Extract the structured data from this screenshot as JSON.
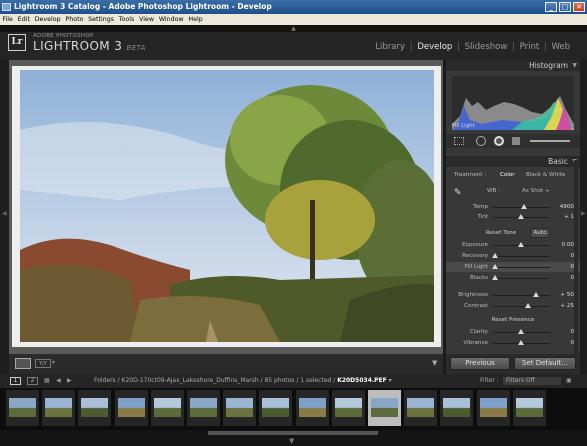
{
  "window": {
    "title": "Lightroom 3 Catalog - Adobe Photoshop Lightroom - Develop",
    "min": "_",
    "max": "□",
    "close": "✕"
  },
  "menu": [
    "File",
    "Edit",
    "Develop",
    "Photo",
    "Settings",
    "Tools",
    "View",
    "Window",
    "Help"
  ],
  "identity": {
    "adobe": "ADOBE PHOTOSHOP",
    "name": "LIGHTROOM 3",
    "beta": "BETA",
    "logo": "Lr"
  },
  "modules": [
    "Library",
    "Develop",
    "Slideshow",
    "Print",
    "Web"
  ],
  "panels": {
    "histogram": {
      "title": "Histogram",
      "label": "Fill Light"
    },
    "basic": {
      "title": "Basic",
      "treatment_label": "Treatment :",
      "color": "Color",
      "bw": "Black & White",
      "wb_label": "WB :",
      "wb_value": "As Shot ÷",
      "temp": {
        "label": "Temp",
        "value": "4900",
        "pos": 0.55
      },
      "tint": {
        "label": "Tint",
        "value": "+ 1",
        "pos": 0.5
      },
      "tone_label": "Reset Tone",
      "auto": "Auto",
      "exposure": {
        "label": "Exposure",
        "value": "0.00",
        "pos": 0.5
      },
      "recovery": {
        "label": "Recovery",
        "value": "0",
        "pos": 0.05
      },
      "filllight": {
        "label": "Fill Light",
        "value": "0",
        "pos": 0.05
      },
      "blacks": {
        "label": "Blacks",
        "value": "0",
        "pos": 0.05
      },
      "brightness": {
        "label": "Brightness",
        "value": "+ 50",
        "pos": 0.75
      },
      "contrast": {
        "label": "Contrast",
        "value": "+ 25",
        "pos": 0.62
      },
      "presence_label": "Reset Presence",
      "clarity": {
        "label": "Clarity",
        "value": "0",
        "pos": 0.5
      },
      "vibrance": {
        "label": "Vibrance",
        "value": "0",
        "pos": 0.5
      }
    }
  },
  "buttons": {
    "previous": "Previous",
    "set_default": "Set Default..."
  },
  "filmbar": {
    "page1": "1",
    "page2": "2",
    "path": "Folders / K20D-170ct09-Ajax_Lakeshore_Duffins_Marsh / 85 photos / 1 selected /",
    "file": "K20D5034.PEF",
    "filter_label": "Filter :",
    "filter_value": "Filters Off"
  },
  "colors": {
    "accent": "#e8e8e8",
    "selected_thumb": "#bdbdbd"
  },
  "icons": {
    "window": "app-icon",
    "filmstrip": "grid-icon",
    "nav": "arrow-icons"
  }
}
